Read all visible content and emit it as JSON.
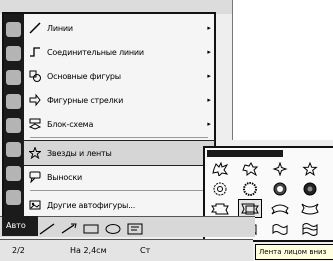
{
  "menu": {
    "items": [
      {
        "label": "Линии",
        "icon": "lines-icon",
        "has_submenu": true
      },
      {
        "label": "Соединительные линии",
        "icon": "connector-icon",
        "has_submenu": true
      },
      {
        "label": "Основные фигуры",
        "icon": "basic-shapes-icon",
        "has_submenu": true
      },
      {
        "label": "Фигурные стрелки",
        "icon": "block-arrows-icon",
        "has_submenu": true
      },
      {
        "label": "Блок-схема",
        "icon": "flowchart-icon",
        "has_submenu": true
      },
      {
        "label": "Звезды и ленты",
        "icon": "stars-banners-icon",
        "has_submenu": true,
        "active": true
      },
      {
        "label": "Выноски",
        "icon": "callouts-icon",
        "has_submenu": true
      },
      {
        "label": "Другие автофигуры...",
        "icon": "more-autoshapes-icon",
        "has_submenu": false
      }
    ],
    "arrow": "▸"
  },
  "submenu": {
    "shapes": [
      "explosion-1-icon",
      "explosion-2-icon",
      "star-4-icon",
      "star-5-icon",
      "seal-8-icon",
      "seal-16-icon",
      "seal-24-icon",
      "seal-32-icon",
      "up-ribbon-icon",
      "down-ribbon-icon",
      "curved-up-ribbon-icon",
      "curved-down-ribbon-icon",
      "vertical-scroll-icon",
      "horizontal-scroll-icon",
      "wave-icon",
      "double-wave-icon"
    ],
    "selected_index": 9
  },
  "tooltip": {
    "text": "Лента лицом вниз"
  },
  "toolbar": {
    "autoshapes_label": "Авто"
  },
  "statusbar": {
    "page": "2/2",
    "position": "На 2,4см",
    "col_label": "Ст"
  }
}
